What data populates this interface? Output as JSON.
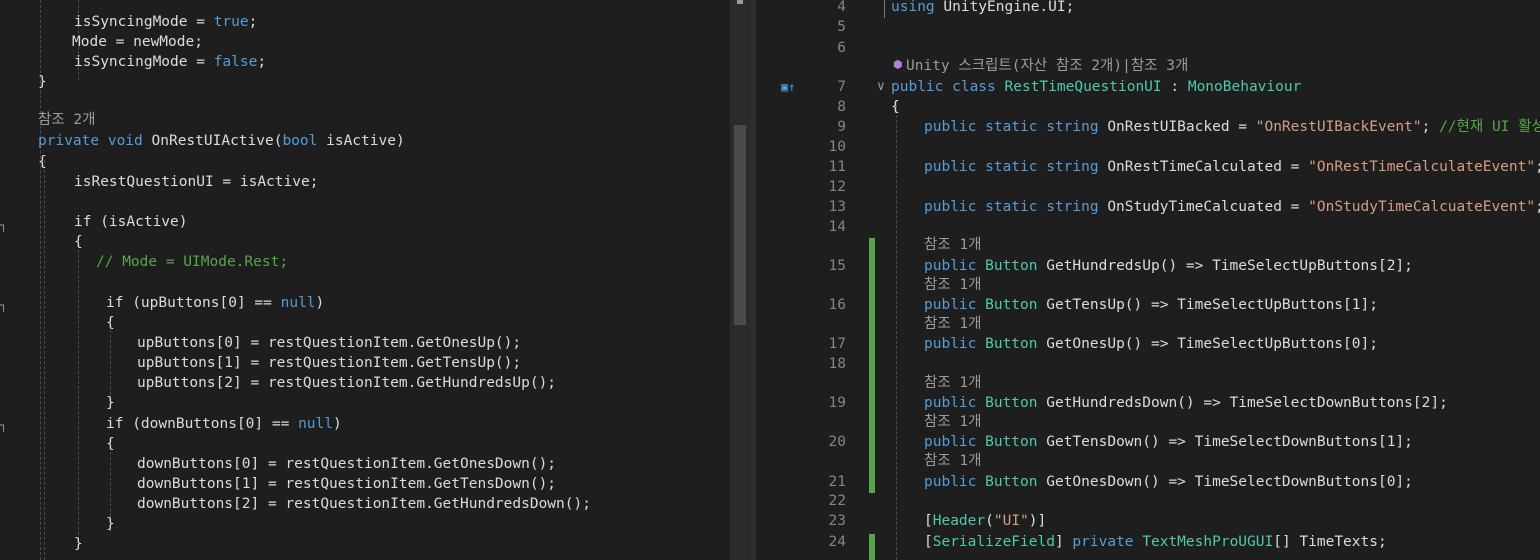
{
  "left_editor": {
    "lines": [
      {
        "tokens": [
          {
            "t": "isSyncingMode = ",
            "c": "pl"
          },
          {
            "t": "true",
            "c": "kw"
          },
          {
            "t": ";",
            "c": "pl"
          }
        ]
      },
      {
        "tokens": [
          {
            "t": "Mode = newMode;",
            "c": "pl"
          }
        ]
      },
      {
        "tokens": [
          {
            "t": "isSyncingMode = ",
            "c": "pl"
          },
          {
            "t": "false",
            "c": "kw"
          },
          {
            "t": ";",
            "c": "pl"
          }
        ]
      },
      {
        "tokens": [
          {
            "t": "}",
            "c": "pl"
          }
        ]
      },
      {
        "tokens": []
      },
      {
        "tokens": [
          {
            "t": "참조 2개",
            "c": "ref"
          }
        ]
      },
      {
        "tokens": [
          {
            "t": "private ",
            "c": "kw"
          },
          {
            "t": "void ",
            "c": "kw"
          },
          {
            "t": "OnRestUIActive(",
            "c": "pl"
          },
          {
            "t": "bool ",
            "c": "kw"
          },
          {
            "t": "isActive)",
            "c": "pl"
          }
        ]
      },
      {
        "tokens": [
          {
            "t": "{",
            "c": "pl"
          }
        ]
      },
      {
        "tokens": [
          {
            "t": "isRestQuestionUI = isActive;",
            "c": "pl"
          }
        ]
      },
      {
        "tokens": []
      },
      {
        "tokens": [
          {
            "t": "if (isActive)",
            "c": "pl"
          }
        ]
      },
      {
        "tokens": [
          {
            "t": "{",
            "c": "pl"
          }
        ]
      },
      {
        "tokens": [
          {
            "t": "// Mode = UIMode.Rest;",
            "c": "cm"
          }
        ]
      },
      {
        "tokens": []
      },
      {
        "tokens": [
          {
            "t": "if (upButtons[0] == ",
            "c": "pl"
          },
          {
            "t": "null",
            "c": "kw"
          },
          {
            "t": ")",
            "c": "pl"
          }
        ]
      },
      {
        "tokens": [
          {
            "t": "{",
            "c": "pl"
          }
        ]
      },
      {
        "tokens": [
          {
            "t": "upButtons[0] = restQuestionItem.GetOnesUp();",
            "c": "pl"
          }
        ]
      },
      {
        "tokens": [
          {
            "t": "upButtons[1] = restQuestionItem.GetTensUp();",
            "c": "pl"
          }
        ]
      },
      {
        "tokens": [
          {
            "t": "upButtons[2] = restQuestionItem.GetHundredsUp();",
            "c": "pl"
          }
        ]
      },
      {
        "tokens": [
          {
            "t": "}",
            "c": "pl"
          }
        ]
      },
      {
        "tokens": [
          {
            "t": "if (downButtons[0] == ",
            "c": "pl"
          },
          {
            "t": "null",
            "c": "kw"
          },
          {
            "t": ")",
            "c": "pl"
          }
        ]
      },
      {
        "tokens": [
          {
            "t": "{",
            "c": "pl"
          }
        ]
      },
      {
        "tokens": [
          {
            "t": "downButtons[0] = restQuestionItem.GetOnesDown();",
            "c": "pl"
          }
        ]
      },
      {
        "tokens": [
          {
            "t": "downButtons[1] = restQuestionItem.GetTensDown();",
            "c": "pl"
          }
        ]
      },
      {
        "tokens": [
          {
            "t": "downButtons[2] = restQuestionItem.GetHundredsDown();",
            "c": "pl"
          }
        ]
      },
      {
        "tokens": [
          {
            "t": "}",
            "c": "pl"
          }
        ]
      },
      {
        "tokens": [
          {
            "t": "}",
            "c": "pl"
          }
        ]
      }
    ]
  },
  "right_editor": {
    "lines": [
      {
        "num": "4",
        "tokens": [
          {
            "t": "using ",
            "c": "kw"
          },
          {
            "t": "UnityEngine.UI;",
            "c": "pl"
          }
        ]
      },
      {
        "num": "5",
        "tokens": []
      },
      {
        "num": "6",
        "tokens": []
      },
      {
        "num": "",
        "tokens": [
          {
            "t": "Unity 스크립트(자산 참조 2개)|참조 3개",
            "c": "ref"
          }
        ]
      },
      {
        "num": "7",
        "tokens": [
          {
            "t": "public ",
            "c": "kw"
          },
          {
            "t": "class ",
            "c": "kw"
          },
          {
            "t": "RestTimeQuestionUI",
            "c": "ty"
          },
          {
            "t": " : ",
            "c": "pl"
          },
          {
            "t": "MonoBehaviour",
            "c": "ty"
          }
        ]
      },
      {
        "num": "8",
        "tokens": [
          {
            "t": "{",
            "c": "pl"
          }
        ]
      },
      {
        "num": "9",
        "tokens": [
          {
            "t": "public ",
            "c": "kw"
          },
          {
            "t": "static ",
            "c": "kw"
          },
          {
            "t": "string ",
            "c": "kw"
          },
          {
            "t": "OnRestUIBacked = ",
            "c": "pl"
          },
          {
            "t": "\"OnRestUIBackEvent\"",
            "c": "st"
          },
          {
            "t": "; ",
            "c": "pl"
          },
          {
            "t": "//현재 UI 활성화",
            "c": "cm"
          }
        ]
      },
      {
        "num": "10",
        "tokens": []
      },
      {
        "num": "11",
        "tokens": [
          {
            "t": "public ",
            "c": "kw"
          },
          {
            "t": "static ",
            "c": "kw"
          },
          {
            "t": "string ",
            "c": "kw"
          },
          {
            "t": "OnRestTimeCalculated = ",
            "c": "pl"
          },
          {
            "t": "\"OnRestTimeCalculateEvent\"",
            "c": "st"
          },
          {
            "t": ";  ",
            "c": "pl"
          },
          {
            "t": "//",
            "c": "cm"
          }
        ]
      },
      {
        "num": "12",
        "tokens": []
      },
      {
        "num": "13",
        "tokens": [
          {
            "t": "public ",
            "c": "kw"
          },
          {
            "t": "static ",
            "c": "kw"
          },
          {
            "t": "string ",
            "c": "kw"
          },
          {
            "t": "OnStudyTimeCalcuated = ",
            "c": "pl"
          },
          {
            "t": "\"OnStudyTimeCalcuateEvent\"",
            "c": "st"
          },
          {
            "t": ";",
            "c": "pl"
          }
        ]
      },
      {
        "num": "14",
        "tokens": []
      },
      {
        "num": "",
        "tokens": [
          {
            "t": "참조 1개",
            "c": "ref"
          }
        ]
      },
      {
        "num": "15",
        "tokens": [
          {
            "t": "public ",
            "c": "kw"
          },
          {
            "t": "Button",
            "c": "ty"
          },
          {
            "t": " GetHundredsUp() => TimeSelectUpButtons[2];",
            "c": "pl"
          }
        ]
      },
      {
        "num": "",
        "tokens": [
          {
            "t": "참조 1개",
            "c": "ref"
          }
        ]
      },
      {
        "num": "16",
        "tokens": [
          {
            "t": "public ",
            "c": "kw"
          },
          {
            "t": "Button",
            "c": "ty"
          },
          {
            "t": " GetTensUp() => TimeSelectUpButtons[1];",
            "c": "pl"
          }
        ]
      },
      {
        "num": "",
        "tokens": [
          {
            "t": "참조 1개",
            "c": "ref"
          }
        ]
      },
      {
        "num": "17",
        "tokens": [
          {
            "t": "public ",
            "c": "kw"
          },
          {
            "t": "Button",
            "c": "ty"
          },
          {
            "t": " GetOnesUp() => TimeSelectUpButtons[0];",
            "c": "pl"
          }
        ]
      },
      {
        "num": "18",
        "tokens": []
      },
      {
        "num": "",
        "tokens": [
          {
            "t": "참조 1개",
            "c": "ref"
          }
        ]
      },
      {
        "num": "19",
        "tokens": [
          {
            "t": "public ",
            "c": "kw"
          },
          {
            "t": "Button",
            "c": "ty"
          },
          {
            "t": " GetHundredsDown() => TimeSelectDownButtons[2];",
            "c": "pl"
          }
        ]
      },
      {
        "num": "",
        "tokens": [
          {
            "t": "참조 1개",
            "c": "ref"
          }
        ]
      },
      {
        "num": "20",
        "tokens": [
          {
            "t": "public ",
            "c": "kw"
          },
          {
            "t": "Button",
            "c": "ty"
          },
          {
            "t": " GetTensDown() => TimeSelectDownButtons[1];",
            "c": "pl"
          }
        ]
      },
      {
        "num": "",
        "tokens": [
          {
            "t": "참조 1개",
            "c": "ref"
          }
        ]
      },
      {
        "num": "21",
        "tokens": [
          {
            "t": "public ",
            "c": "kw"
          },
          {
            "t": "Button",
            "c": "ty"
          },
          {
            "t": " GetOnesDown() => TimeSelectDownButtons[0];",
            "c": "pl"
          }
        ]
      },
      {
        "num": "22",
        "tokens": []
      },
      {
        "num": "23",
        "tokens": [
          {
            "t": "[",
            "c": "pl"
          },
          {
            "t": "Header",
            "c": "ty"
          },
          {
            "t": "(",
            "c": "pl"
          },
          {
            "t": "\"UI\"",
            "c": "st"
          },
          {
            "t": ")]",
            "c": "pl"
          }
        ]
      },
      {
        "num": "24",
        "tokens": [
          {
            "t": "[",
            "c": "pl"
          },
          {
            "t": "SerializeField",
            "c": "ty"
          },
          {
            "t": "] ",
            "c": "pl"
          },
          {
            "t": "private ",
            "c": "kw"
          },
          {
            "t": "TextMeshProUGUI",
            "c": "ty"
          },
          {
            "t": "[] TimeTexts;",
            "c": "pl"
          }
        ]
      }
    ]
  },
  "theme": {
    "background": "#1e1e1e",
    "keyword": "#569cd6",
    "type": "#4ec9b0",
    "string": "#d69d85",
    "comment": "#57a64a",
    "change_bar": "#57a64a"
  },
  "icons": {
    "unity_asset": "unity-cube-icon",
    "inherit_margin": "inheritance-glyph-icon"
  }
}
